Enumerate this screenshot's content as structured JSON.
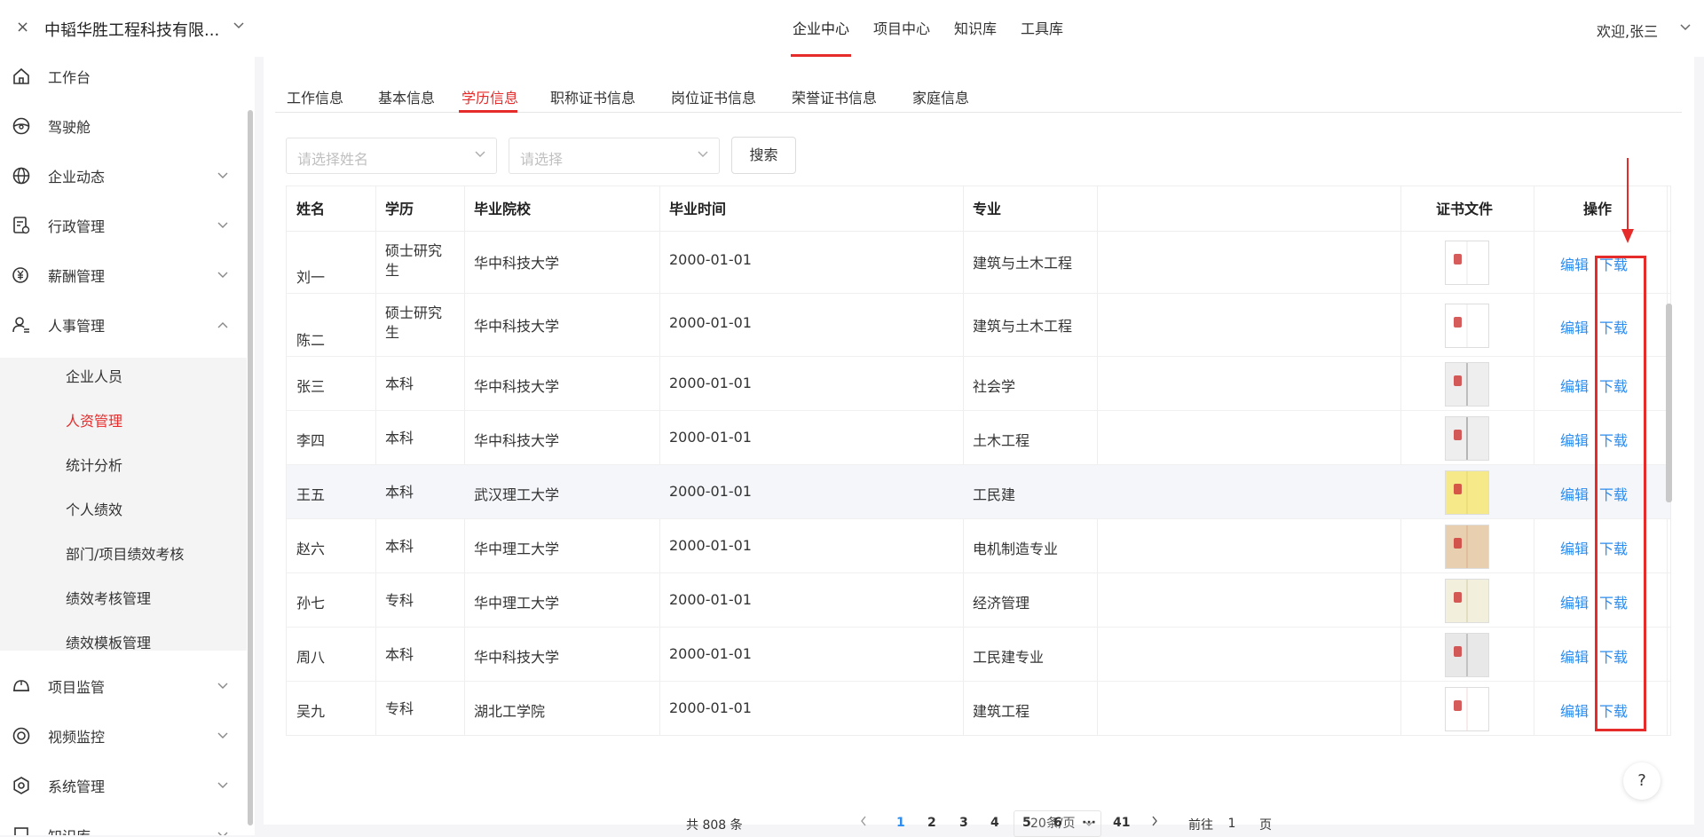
{
  "header": {
    "close_glyph": "×",
    "company": "中韬华胜工程科技有限...",
    "nav": [
      "企业中心",
      "项目中心",
      "知识库",
      "工具库"
    ],
    "welcome": "欢迎,张三"
  },
  "sidebar": {
    "items": [
      {
        "label": "工作台",
        "icon": "home-icon"
      },
      {
        "label": "驾驶舱",
        "icon": "steering-wheel-icon"
      },
      {
        "label": "企业动态",
        "icon": "globe-icon"
      },
      {
        "label": "行政管理",
        "icon": "document-settings-icon"
      },
      {
        "label": "薪酬管理",
        "icon": "yen-icon"
      },
      {
        "label": "人事管理",
        "icon": "user-icon"
      },
      {
        "label": "项目监管",
        "icon": "helmet-icon"
      },
      {
        "label": "视频监控",
        "icon": "camera-icon"
      },
      {
        "label": "系统管理",
        "icon": "settings-icon"
      },
      {
        "label": "知识库",
        "icon": "book-icon"
      }
    ],
    "subitems": [
      "企业人员",
      "人资管理",
      "统计分析",
      "个人绩效",
      "部门/项目绩效考核",
      "绩效考核管理",
      "绩效模板管理"
    ]
  },
  "tabs": [
    "工作信息",
    "基本信息",
    "学历信息",
    "职称证书信息",
    "岗位证书信息",
    "荣誉证书信息",
    "家庭信息"
  ],
  "filters": {
    "name_placeholder": "请选择姓名",
    "select_placeholder": "请选择",
    "search_label": "搜索"
  },
  "table": {
    "columns": [
      "姓名",
      "学历",
      "毕业院校",
      "毕业时间",
      "专业",
      "证书文件",
      "操作"
    ],
    "rows": [
      {
        "name": "刘一",
        "degree": "硕士研究生",
        "school": "华中科技大学",
        "date": "2000-01-01",
        "major": "建筑与土木工程"
      },
      {
        "name": "陈二",
        "degree": "硕士研究生",
        "school": "华中科技大学",
        "date": "2000-01-01",
        "major": "建筑与土木工程"
      },
      {
        "name": "张三",
        "degree": "本科",
        "school": "华中科技大学",
        "date": "2000-01-01",
        "major": "社会学"
      },
      {
        "name": "李四",
        "degree": "本科",
        "school": "华中科技大学",
        "date": "2000-01-01",
        "major": "土木工程"
      },
      {
        "name": "王五",
        "degree": "本科",
        "school": "武汉理工大学",
        "date": "2000-01-01",
        "major": "工民建"
      },
      {
        "name": "赵六",
        "degree": "本科",
        "school": "华中理工大学",
        "date": "2000-01-01",
        "major": "电机制造专业"
      },
      {
        "name": "孙七",
        "degree": "专科",
        "school": "华中理工大学",
        "date": "2000-01-01",
        "major": "经济管理"
      },
      {
        "name": "周八",
        "degree": "本科",
        "school": "华中科技大学",
        "date": "2000-01-01",
        "major": "工民建专业"
      },
      {
        "name": "吴九",
        "degree": "专科",
        "school": "湖北工学院",
        "date": "2000-01-01",
        "major": "建筑工程"
      }
    ],
    "edit_label": "编辑",
    "download_label": "下载"
  },
  "pagination": {
    "total": "共 808 条",
    "page_size": "20条/页",
    "pages": [
      "1",
      "2",
      "3",
      "4",
      "5",
      "6",
      "···",
      "41"
    ],
    "goto_prefix": "前往",
    "goto_value": "1",
    "goto_suffix": "页"
  },
  "help_label": "?",
  "colors": {
    "accent": "#e62b2b",
    "link": "#2d8cf0"
  }
}
